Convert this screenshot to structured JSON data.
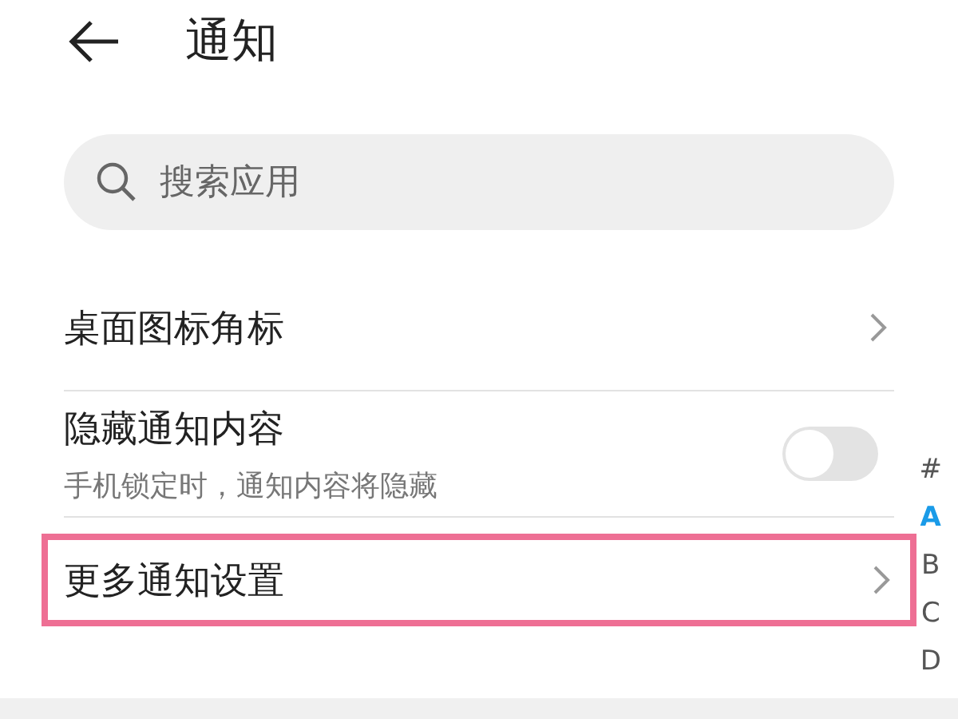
{
  "header": {
    "title": "通知"
  },
  "search": {
    "placeholder": "搜索应用"
  },
  "settings": [
    {
      "kind": "link",
      "label": "桌面图标角标",
      "highlighted": false
    },
    {
      "kind": "toggle",
      "label": "隐藏通知内容",
      "description": "手机锁定时，通知内容将隐藏",
      "on": false,
      "highlighted": false
    },
    {
      "kind": "link",
      "label": "更多通知设置",
      "highlighted": true
    }
  ],
  "alphabet_index": [
    {
      "label": "#",
      "selected": false
    },
    {
      "label": "A",
      "selected": true
    },
    {
      "label": "B",
      "selected": false
    },
    {
      "label": "C",
      "selected": false
    },
    {
      "label": "D",
      "selected": false
    }
  ]
}
